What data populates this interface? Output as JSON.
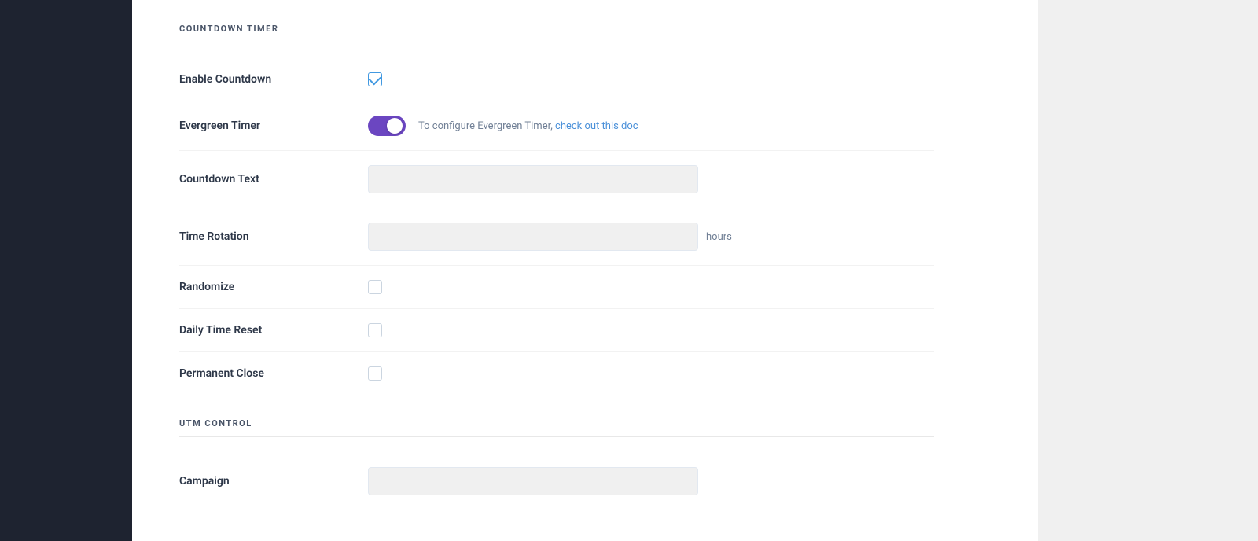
{
  "sidebar": {
    "background": "#1e2330"
  },
  "sections": [
    {
      "id": "countdown-timer",
      "title": "COUNTDOWN TIMER",
      "fields": [
        {
          "id": "enable-countdown",
          "label": "Enable Countdown",
          "type": "checkbox",
          "checked": true
        },
        {
          "id": "evergreen-timer",
          "label": "Evergreen Timer",
          "type": "toggle",
          "enabled": true,
          "hint": "To configure Evergreen Timer,",
          "link_text": "check out this doc",
          "link_href": "#"
        },
        {
          "id": "countdown-text",
          "label": "Countdown Text",
          "type": "text-input",
          "value": "",
          "placeholder": ""
        },
        {
          "id": "time-rotation",
          "label": "Time Rotation",
          "type": "text-input-suffix",
          "value": "",
          "placeholder": "",
          "suffix": "hours"
        },
        {
          "id": "randomize",
          "label": "Randomize",
          "type": "checkbox",
          "checked": false
        },
        {
          "id": "daily-time-reset",
          "label": "Daily Time Reset",
          "type": "checkbox",
          "checked": false
        },
        {
          "id": "permanent-close",
          "label": "Permanent Close",
          "type": "checkbox",
          "checked": false
        }
      ]
    },
    {
      "id": "utm-control",
      "title": "UTM CONTROL",
      "fields": [
        {
          "id": "campaign",
          "label": "Campaign",
          "type": "text-input",
          "value": "",
          "placeholder": ""
        }
      ]
    }
  ],
  "labels": {
    "hours_suffix": "hours",
    "evergreen_hint": "To configure Evergreen Timer,",
    "evergreen_link": "check out this doc"
  }
}
